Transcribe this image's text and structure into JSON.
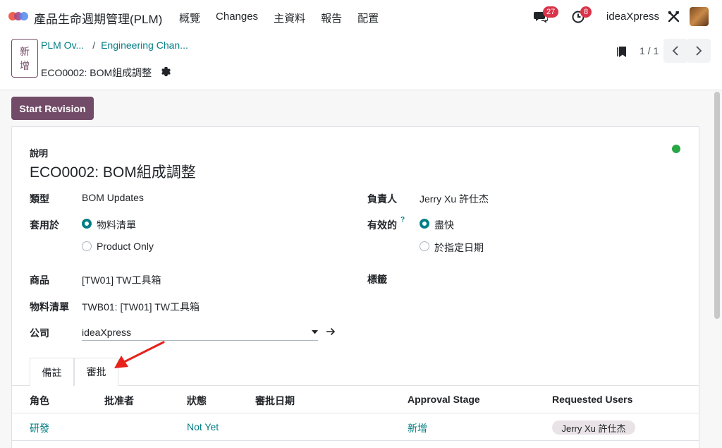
{
  "app": {
    "title": "產品生命週期管理(PLM)",
    "menu": [
      "概覽",
      "Changes",
      "主資料",
      "報告",
      "配置"
    ],
    "messages_count": "27",
    "activities_count": "8",
    "company": "ideaXpress"
  },
  "control": {
    "new_label_1": "新",
    "new_label_2": "增",
    "breadcrumb_1": "PLM Ov...",
    "breadcrumb_2": "Engineering Chan...",
    "breadcrumb_sep": "/",
    "record_title": "ECO0002: BOM組成調整",
    "pager": "1 / 1"
  },
  "action": {
    "start_revision": "Start Revision"
  },
  "form": {
    "desc_label": "說明",
    "desc_value": "ECO0002: BOM組成調整",
    "type_label": "類型",
    "type_value": "BOM Updates",
    "apply_label": "套用於",
    "apply_opt1": "物料清單",
    "apply_opt2": "Product Only",
    "product_label": "商品",
    "product_value": "[TW01] TW工具箱",
    "bom_label": "物料清單",
    "bom_value": "TWB01: [TW01] TW工具箱",
    "company_label": "公司",
    "company_value": "ideaXpress",
    "responsible_label": "負責人",
    "responsible_value": "Jerry Xu 許仕杰",
    "effective_label": "有效的",
    "effective_help": "?",
    "effective_opt1": "盡快",
    "effective_opt2": "於指定日期",
    "tags_label": "標籤"
  },
  "tabs": {
    "notes": "備註",
    "approvals": "審批"
  },
  "table": {
    "headers": [
      "角色",
      "批准者",
      "狀態",
      "審批日期",
      "Approval Stage",
      "Requested Users"
    ],
    "row": {
      "role": "研發",
      "status": "Not Yet",
      "stage": "新增",
      "user": "Jerry Xu 許仕杰"
    }
  },
  "colors": {
    "brand": "#714b67",
    "link": "#017e84",
    "badge": "#d9344a",
    "status_green": "#28a745",
    "annotation_arrow": "#e8201a"
  }
}
